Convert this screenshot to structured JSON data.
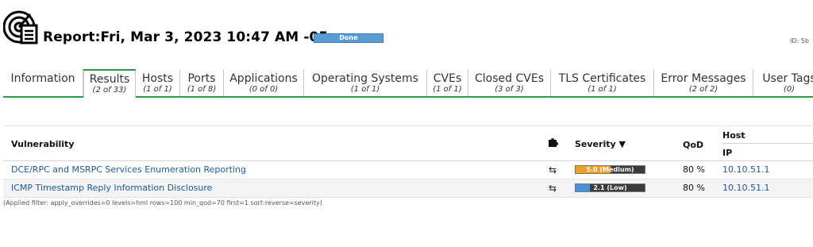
{
  "report": {
    "title": "Report:Fri, Mar 3, 2023 10:47 AM -05",
    "status": "Done",
    "id_label": "ID: 5b"
  },
  "tabs": [
    {
      "label": "Information",
      "count": ""
    },
    {
      "label": "Results",
      "count": "(2 of 33)"
    },
    {
      "label": "Hosts",
      "count": "(1 of 1)"
    },
    {
      "label": "Ports",
      "count": "(1 of 8)"
    },
    {
      "label": "Applications",
      "count": "(0 of 0)"
    },
    {
      "label": "Operating Systems",
      "count": "(1 of 1)"
    },
    {
      "label": "CVEs",
      "count": "(1 of 1)"
    },
    {
      "label": "Closed CVEs",
      "count": "(3 of 3)"
    },
    {
      "label": "TLS Certificates",
      "count": "(1 of 1)"
    },
    {
      "label": "Error Messages",
      "count": "(2 of 2)"
    },
    {
      "label": "User Tags",
      "count": "(0)"
    }
  ],
  "table": {
    "headers": {
      "vulnerability": "Vulnerability",
      "severity": "Severity ▼",
      "qod": "QoD",
      "host": "Host",
      "ip": "IP"
    },
    "rows": [
      {
        "name": "DCE/RPC and MSRPC Services Enumeration Reporting",
        "severity_label": "5.0 (Medium)",
        "severity_value": 5.0,
        "severity_color": "#f0a020",
        "qod": "80 %",
        "ip": "10.10.51.1"
      },
      {
        "name": "ICMP Timestamp Reply Information Disclosure",
        "severity_label": "2.1 (Low)",
        "severity_value": 2.1,
        "severity_color": "#4a90d9",
        "qod": "80 %",
        "ip": "10.10.51.1"
      }
    ]
  },
  "filter_text": "(Applied filter: apply_overrides=0 levels=hml rows=100 min_qod=70 first=1 sort-reverse=severity)",
  "colors": {
    "accent": "#2a9d48",
    "link": "#1d5aa6",
    "done_bar": "#5b9bd5"
  }
}
